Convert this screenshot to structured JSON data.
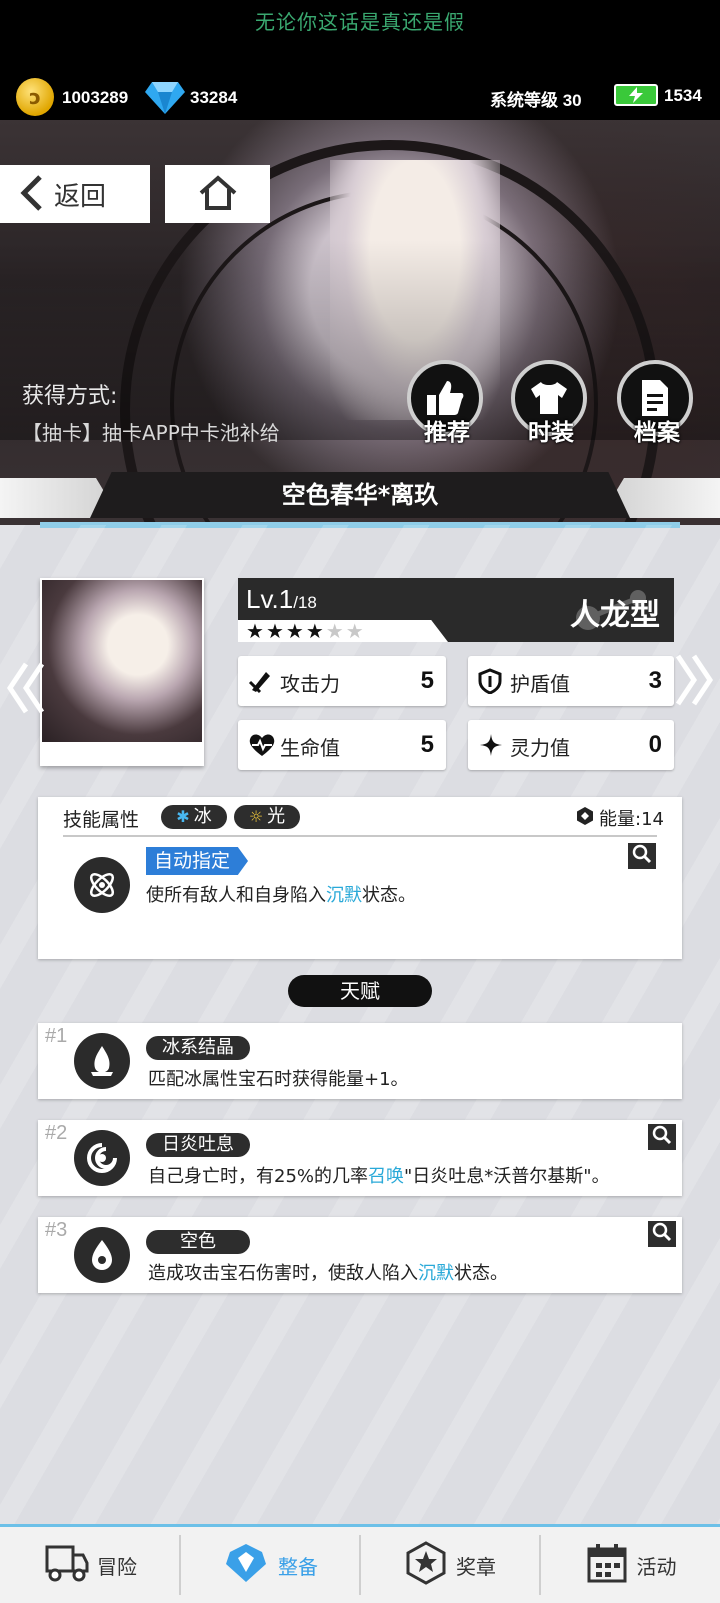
{
  "marquee": "无论你这话是真还是假",
  "resources": {
    "coins": "1003289",
    "diamonds": "33284",
    "system_level": "系统等级 30",
    "energy": "1534"
  },
  "nav": {
    "back_label": "返回"
  },
  "acquire": {
    "label": "获得方式:",
    "source": "【抽卡】抽卡APP中卡池补给"
  },
  "actions": [
    {
      "label": "推荐",
      "icon": "thumbs-up-icon"
    },
    {
      "label": "时装",
      "icon": "tshirt-icon"
    },
    {
      "label": "档案",
      "icon": "file-icon"
    }
  ],
  "character": {
    "name": "空色春华*离玖",
    "level": "Lv.1",
    "level_max": "/18",
    "stars_filled": 4,
    "stars_total": 6,
    "type": "人龙型",
    "stats": {
      "attack": {
        "label": "攻击力",
        "value": "5"
      },
      "shield": {
        "label": "护盾值",
        "value": "3"
      },
      "hp": {
        "label": "生命值",
        "value": "5"
      },
      "spirit": {
        "label": "灵力值",
        "value": "0"
      }
    }
  },
  "skill": {
    "title": "技能属性",
    "elements": [
      "冰",
      "光"
    ],
    "energy": "能量:14",
    "tag": "自动指定",
    "desc_before": "使所有敌人和自身陷入",
    "desc_highlight": "沉默",
    "desc_after": "状态。"
  },
  "talent_header": "天赋",
  "talents": [
    {
      "num": "#1",
      "name": "冰系结晶",
      "desc_before": "匹配冰属性宝石时获得能量+1。",
      "desc_highlight": "",
      "desc_after": ""
    },
    {
      "num": "#2",
      "name": "日炎吐息",
      "desc_before": "自己身亡时，有25%的几率",
      "desc_highlight": "召唤",
      "desc_after": "\"日炎吐息*沃普尔基斯\"。"
    },
    {
      "num": "#3",
      "name": "空色",
      "desc_before": "造成攻击宝石伤害时，使敌人陷入",
      "desc_highlight": "沉默",
      "desc_after": "状态。"
    }
  ],
  "tabs": [
    {
      "label": "冒险",
      "icon": "truck-icon"
    },
    {
      "label": "整备",
      "icon": "gear-icon"
    },
    {
      "label": "奖章",
      "icon": "medal-icon"
    },
    {
      "label": "活动",
      "icon": "calendar-icon"
    }
  ],
  "colors": {
    "accent": "#29a9d8",
    "dark": "#2d2d2d",
    "active_tab": "#3aa0e8"
  }
}
